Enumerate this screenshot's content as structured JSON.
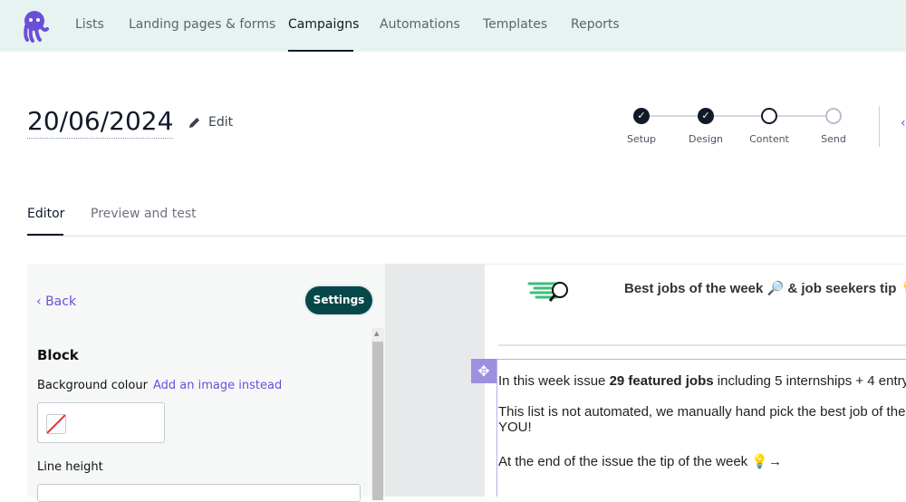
{
  "nav": {
    "items": [
      "Lists",
      "Landing pages & forms",
      "Campaigns",
      "Automations",
      "Templates",
      "Reports"
    ],
    "active": "Campaigns"
  },
  "campaign": {
    "title": "20/06/2024",
    "edit_label": "Edit"
  },
  "stepper": {
    "steps": [
      {
        "label": "Setup",
        "state": "done"
      },
      {
        "label": "Design",
        "state": "done"
      },
      {
        "label": "Content",
        "state": "current"
      },
      {
        "label": "Send",
        "state": "todo"
      }
    ]
  },
  "tabs": {
    "editor": "Editor",
    "preview": "Preview and test"
  },
  "panel": {
    "back": "Back",
    "settings": "Settings",
    "block_heading": "Block",
    "bg_label": "Background colour",
    "bg_link": "Add an image instead",
    "line_height_label": "Line height"
  },
  "email": {
    "heading": "Best jobs of the week 🔎 & job seekers tip 💡",
    "p1_pre": "In this week issue ",
    "p1_bold": "29 featured jobs",
    "p1_post": " including 5 internships + 4 entry",
    "p2a": "This list is not automated, we manually hand pick the best job of the w",
    "p2b": "YOU!",
    "p3": "At the end of the issue the tip of the week 💡→"
  },
  "colors": {
    "accent": "#6a4fd8",
    "nav_bg": "#e7f3f0",
    "settings_bg": "#06484a",
    "step_done": "#111a2a"
  }
}
